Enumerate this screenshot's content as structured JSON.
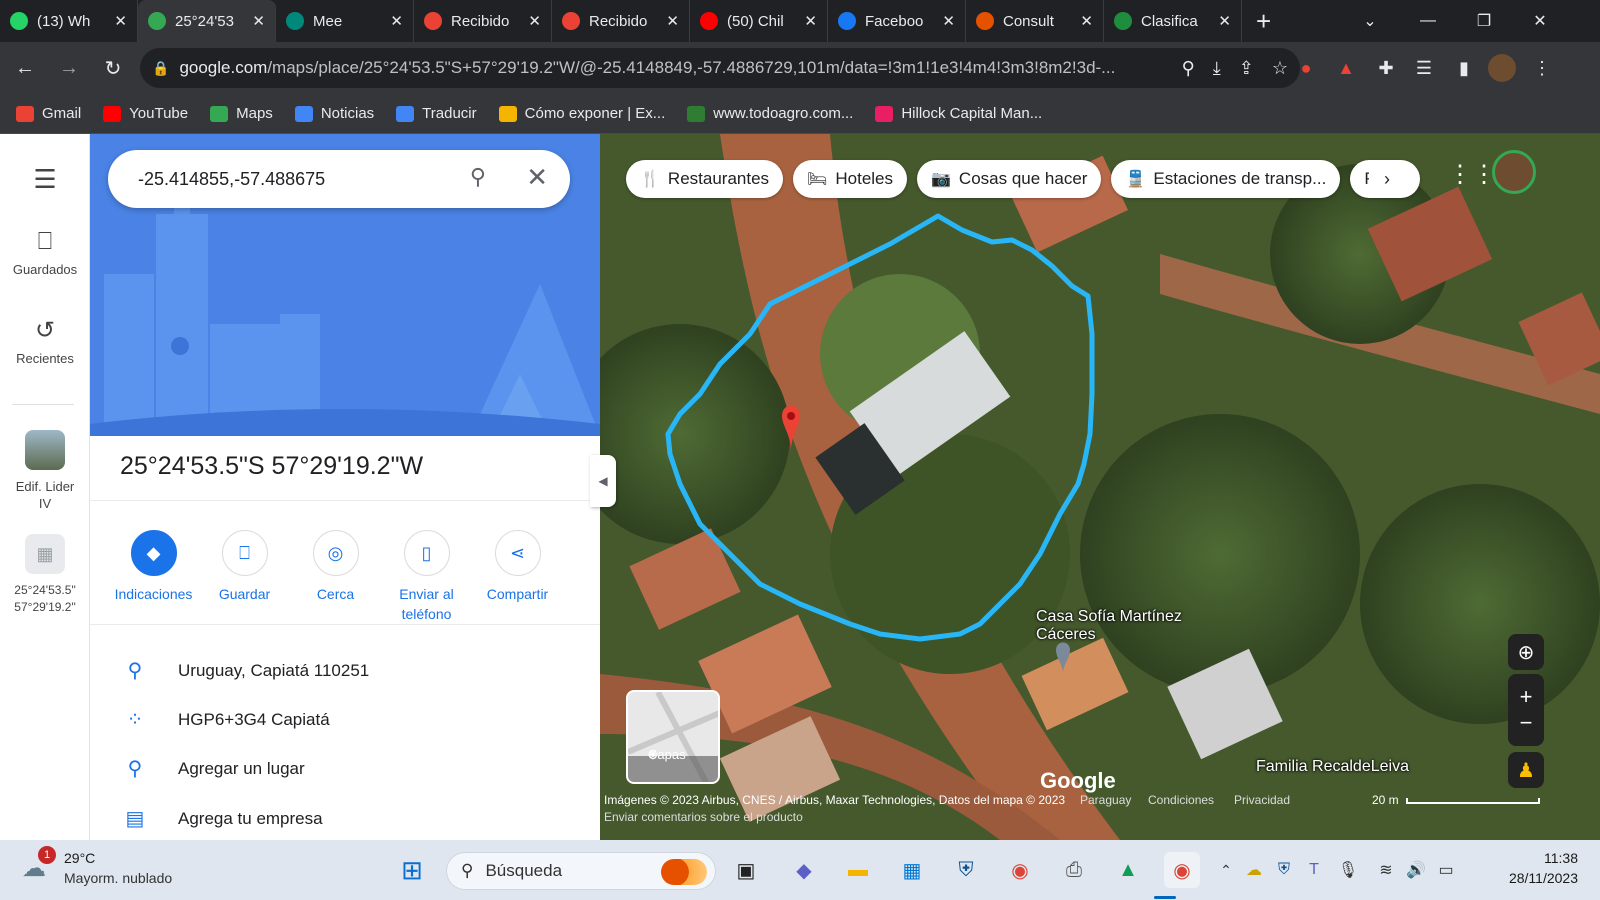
{
  "browser": {
    "tabs": [
      {
        "title": "(13) Wh",
        "icon": "whatsapp-icon",
        "color": "#25d366",
        "badge": "13"
      },
      {
        "title": "25°24'53",
        "icon": "maps-pin-icon",
        "color": "#34a853",
        "active": true
      },
      {
        "title": "Mee",
        "icon": "meet-icon",
        "color": "#00897b"
      },
      {
        "title": "Recibido",
        "icon": "gmail-icon",
        "color": "#ea4335"
      },
      {
        "title": "Recibido",
        "icon": "gmail-icon",
        "color": "#ea4335"
      },
      {
        "title": "(50) Chil",
        "icon": "youtube-icon",
        "color": "#ff0000"
      },
      {
        "title": "Faceboo",
        "icon": "facebook-icon",
        "color": "#1877f2"
      },
      {
        "title": "Consult",
        "icon": "consult-icon",
        "color": "#e65100"
      },
      {
        "title": "Clasifica",
        "icon": "classroom-icon",
        "color": "#1e8e3e"
      }
    ],
    "url_domain": "google.com",
    "url_path": "/maps/place/25°24'53.5\"S+57°29'19.2\"W/@-25.4148849,-57.4886729,101m/data=!3m1!1e3!4m4!3m3!8m2!3d-...",
    "bookmarks": [
      {
        "label": "Gmail",
        "icon": "gmail-icon",
        "color": "#ea4335"
      },
      {
        "label": "YouTube",
        "icon": "youtube-icon",
        "color": "#ff0000"
      },
      {
        "label": "Maps",
        "icon": "maps-pin-icon",
        "color": "#34a853"
      },
      {
        "label": "Noticias",
        "icon": "news-icon",
        "color": "#4285f4"
      },
      {
        "label": "Traducir",
        "icon": "translate-icon",
        "color": "#4285f4"
      },
      {
        "label": "Cómo exponer | Ex...",
        "icon": "web-icon",
        "color": "#f4b400"
      },
      {
        "label": "www.todoagro.com...",
        "icon": "leaf-icon",
        "color": "#2e7d32"
      },
      {
        "label": "Hillock Capital Man...",
        "icon": "hillock-icon",
        "color": "#e91e63"
      }
    ]
  },
  "rail": {
    "saved_label": "Guardados",
    "recent_label": "Recientes",
    "recent1_label": "Edif. Lider IV",
    "recent2_label": "25°24'53.5\" 57°29'19.2\""
  },
  "panel": {
    "search_value": "-25.414855,-57.488675",
    "title": "25°24'53.5\"S 57°29'19.2\"W",
    "actions": [
      {
        "label": "Indicaciones",
        "icon": "directions-icon"
      },
      {
        "label": "Guardar",
        "icon": "bookmark-icon"
      },
      {
        "label": "Cerca",
        "icon": "nearby-icon"
      },
      {
        "label": "Enviar al teléfono",
        "icon": "send-to-phone-icon"
      },
      {
        "label": "Compartir",
        "icon": "share-icon"
      }
    ],
    "address": "Uruguay, Capiatá 110251",
    "plus_code": "HGP6+3G4 Capiatá",
    "add_place": "Agregar un lugar",
    "add_business": "Agrega tu empresa"
  },
  "map": {
    "chips": [
      {
        "label": "Restaurantes",
        "icon": "fork-knife-icon"
      },
      {
        "label": "Hoteles",
        "icon": "bed-icon"
      },
      {
        "label": "Cosas que hacer",
        "icon": "camera-icon"
      },
      {
        "label": "Estaciones de transp...",
        "icon": "transit-icon"
      },
      {
        "label": "P",
        "icon": ""
      }
    ],
    "layers_label": "Capas",
    "place_label_1": "Casa Sofía Martínez Cáceres",
    "place_label_2": "Familia RecaldeLeiva",
    "google_logo": "Google",
    "attribution": "Imágenes © 2023 Airbus, CNES / Airbus, Maxar Technologies, Datos del mapa © 2023",
    "country": "Paraguay",
    "terms": "Condiciones",
    "privacy": "Privacidad",
    "scale": "20 m",
    "feedback": "Enviar comentarios sobre el producto",
    "outline_color": "#29b6f6",
    "pin_color": "#ea4335"
  },
  "taskbar": {
    "weather_temp": "29°C",
    "weather_desc": "Mayorm. nublado",
    "weather_badge": "1",
    "search_placeholder": "Búsqueda",
    "time": "11:38",
    "date": "28/11/2023"
  }
}
